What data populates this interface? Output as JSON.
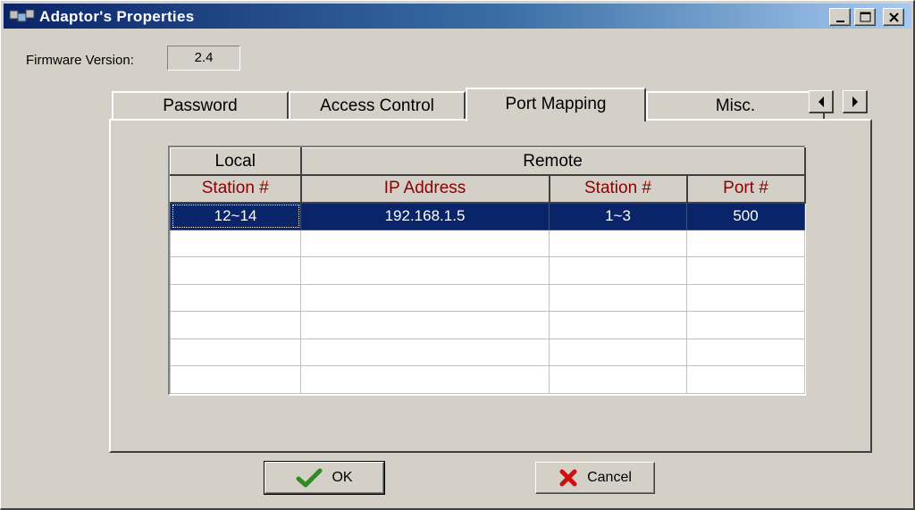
{
  "window": {
    "title": "Adaptor's Properties",
    "icon": "network-adaptor-icon",
    "controls": [
      "minimize-icon",
      "maximize-icon",
      "close-icon"
    ]
  },
  "firmware": {
    "label": "Firmware Version:",
    "value": "2.4"
  },
  "tabs": [
    {
      "label": "Password",
      "selected": false
    },
    {
      "label": "Access Control",
      "selected": false
    },
    {
      "label": "Port Mapping",
      "selected": true
    },
    {
      "label": "Misc.",
      "selected": false
    }
  ],
  "grid": {
    "group_headers": {
      "local": "Local",
      "remote": "Remote"
    },
    "columns": [
      "Station #",
      "IP Address",
      "Station #",
      "Port #"
    ],
    "rows": [
      [
        "12~14",
        "192.168.1.5",
        "1~3",
        "500"
      ],
      [
        "",
        "",
        "",
        ""
      ],
      [
        "",
        "",
        "",
        ""
      ],
      [
        "",
        "",
        "",
        ""
      ],
      [
        "",
        "",
        "",
        ""
      ],
      [
        "",
        "",
        "",
        ""
      ],
      [
        "",
        "",
        "",
        ""
      ]
    ],
    "selected_row": 0
  },
  "buttons": {
    "ok_label": "OK",
    "cancel_label": "Cancel"
  },
  "colors": {
    "selection": "#0a246a",
    "header_text": "#8b0000",
    "ok_check": "#2e8b1e",
    "cancel_x": "#cc1010"
  }
}
